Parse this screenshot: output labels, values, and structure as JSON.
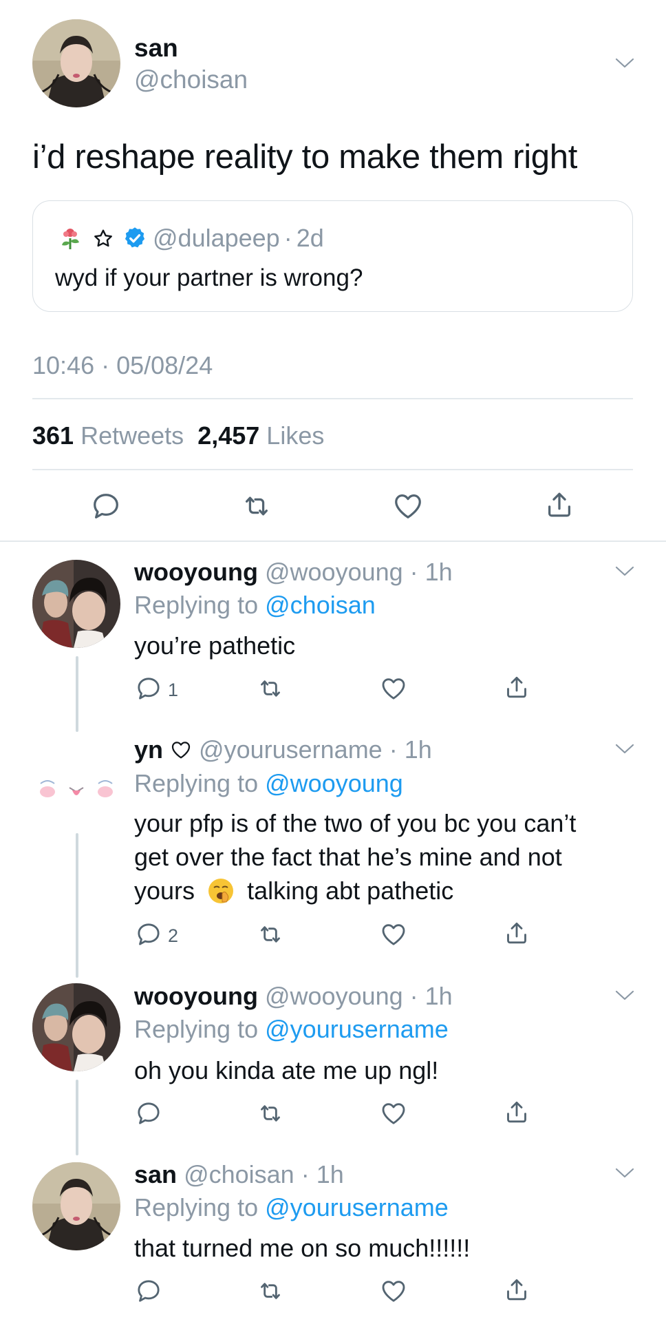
{
  "main_tweet": {
    "name": "san",
    "handle": "@choisan",
    "text": "i’d reshape reality to make them right",
    "quote": {
      "handle": "@dulapeep",
      "time": "2d",
      "text": "wyd if your partner is wrong?",
      "icons": [
        "flower-emoji-icon",
        "star-outline-icon",
        "verified-badge-icon"
      ]
    },
    "timestamp": "10:46 · 05/08/24",
    "retweets_count": "361",
    "retweets_label": "Retweets",
    "likes_count": "2,457",
    "likes_label": "Likes"
  },
  "replies": [
    {
      "name": "wooyoung",
      "handle": "@wooyoung",
      "time": "1h",
      "replying_label": "Replying to",
      "replying_to": "@choisan",
      "text": "you’re pathetic",
      "reply_count": "1"
    },
    {
      "name": "yn",
      "name_icon": "heart-outline-icon",
      "handle": "@yourusername",
      "time": "1h",
      "replying_label": "Replying to",
      "replying_to": "@wooyoung",
      "text_line1": "your pfp is of the two of you bc you can’t",
      "text_line2": "get over the fact that he’s mine and not",
      "text_line3a": "yours",
      "text_emoji_icon": "yawning-face-emoji-icon",
      "text_line3b": "talking abt pathetic",
      "reply_count": "2"
    },
    {
      "name": "wooyoung",
      "handle": "@wooyoung",
      "time": "1h",
      "replying_label": "Replying to",
      "replying_to": "@yourusername",
      "text": "oh you kinda ate me up ngl!",
      "reply_count": ""
    },
    {
      "name": "san",
      "handle": "@choisan",
      "time": "1h",
      "replying_label": "Replying to",
      "replying_to": "@yourusername",
      "text": "that turned me on so much!!!!!!",
      "reply_count": ""
    }
  ],
  "colors": {
    "link_blue": "#1d9bf0",
    "secondary_gray": "#8b98a5",
    "icon_gray": "#536471",
    "divider": "#e3e8ec"
  }
}
